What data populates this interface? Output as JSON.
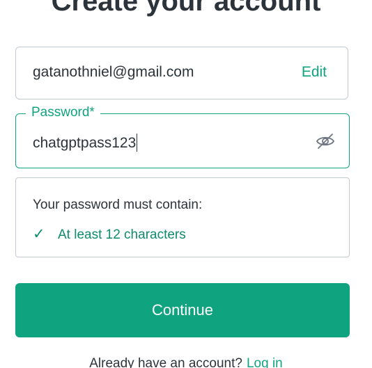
{
  "heading": "Create your account",
  "email": {
    "value": "gatanothniel@gmail.com",
    "edit_label": "Edit"
  },
  "password": {
    "label": "Password*",
    "value": "chatgptpass123",
    "toggle_icon": "eye-slash-icon"
  },
  "requirements": {
    "title": "Your password must contain:",
    "items": [
      {
        "check": "✓",
        "label": "At least 12 characters",
        "met": true
      }
    ]
  },
  "continue_label": "Continue",
  "footer": {
    "prompt": "Already have an account?",
    "login_label": "Log in"
  },
  "colors": {
    "accent": "#10a37f",
    "text": "#2d333a",
    "border": "#c2c8d0"
  }
}
